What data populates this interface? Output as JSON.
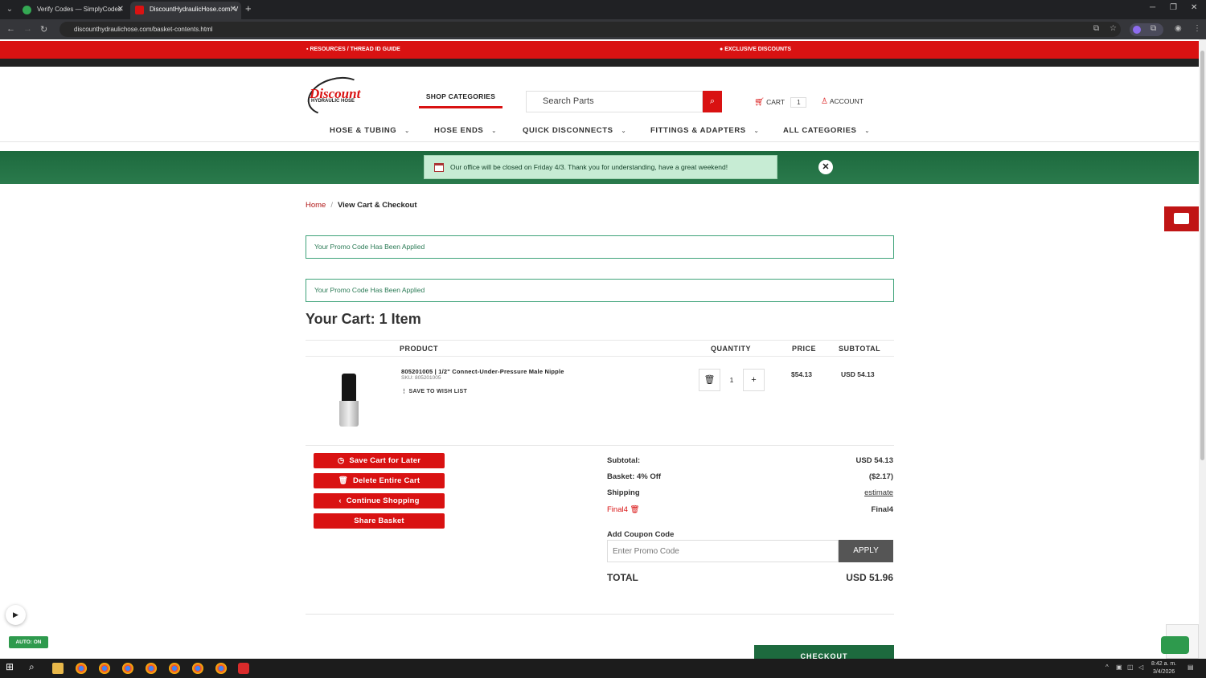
{
  "browser": {
    "tabs": [
      {
        "title": "Verify Codes — SimplyCodes",
        "favicon_color": "#34a853",
        "active": false
      },
      {
        "title": "DiscountHydraulicHose.com: V",
        "favicon_color": "#d91212",
        "active": true
      }
    ],
    "url": "discounthydraulichose.com/basket-contents.html"
  },
  "topbar": {
    "resources_label": "RESOURCES / THREAD ID GUIDE",
    "exclusive_label": "EXCLUSIVE DISCOUNTS"
  },
  "header": {
    "logo_line1": "Discount",
    "logo_line2": "HYDRAULIC HOSE",
    "shop_categories": "SHOP CATEGORIES",
    "search_placeholder": "Search Parts",
    "cart_label": "CART",
    "cart_count": "1",
    "account_label": "ACCOUNT"
  },
  "nav": {
    "items": [
      {
        "label": "HOSE & TUBING"
      },
      {
        "label": "HOSE ENDS"
      },
      {
        "label": "QUICK DISCONNECTS"
      },
      {
        "label": "FITTINGS & ADAPTERS"
      },
      {
        "label": "ALL CATEGORIES"
      }
    ]
  },
  "banner": {
    "message": "Our office will be closed on Friday 4/3. Thank you for understanding, have a great weekend!"
  },
  "breadcrumb": {
    "home": "Home",
    "separator": "/",
    "current": "View Cart & Checkout"
  },
  "alerts": [
    "Your Promo Code Has Been Applied",
    "Your Promo Code Has Been Applied"
  ],
  "cart": {
    "title": "Your Cart: 1 Item",
    "columns": {
      "product": "PRODUCT",
      "quantity": "QUANTITY",
      "price": "PRICE",
      "subtotal": "SUBTOTAL"
    },
    "items": [
      {
        "name": "805201005 | 1/2\" Connect-Under-Pressure Male Nipple",
        "sku": "SKU: 805201005",
        "wishlist": "SAVE TO WISH LIST",
        "quantity": "1",
        "price": "$54.13",
        "subtotal": "USD 54.13"
      }
    ]
  },
  "actions": {
    "save_cart": "Save Cart for Later",
    "delete_cart": "Delete Entire Cart",
    "continue_shopping": "Continue Shopping",
    "share_basket": "Share Basket"
  },
  "summary": {
    "subtotal_label": "Subtotal:",
    "subtotal_value": "USD 54.13",
    "discount_label": "Basket: 4% Off",
    "discount_value": "($2.17)",
    "shipping_label": "Shipping",
    "shipping_value": "estimate",
    "promo_label": "Final4",
    "promo_value": "Final4",
    "coupon_label": "Add Coupon Code",
    "coupon_placeholder": "Enter Promo Code",
    "apply_label": "APPLY",
    "total_label": "TOTAL",
    "total_value": "USD 51.96",
    "checkout_label": "CHECKOUT"
  },
  "widgets": {
    "auto_label": "AUTO: ON"
  },
  "taskbar": {
    "time": "8:42 a. m.",
    "date": "3/4/2026"
  },
  "colors": {
    "brand_red": "#d91212",
    "banner_green": "#1d6a3e",
    "promo_green": "#2a7a55"
  }
}
